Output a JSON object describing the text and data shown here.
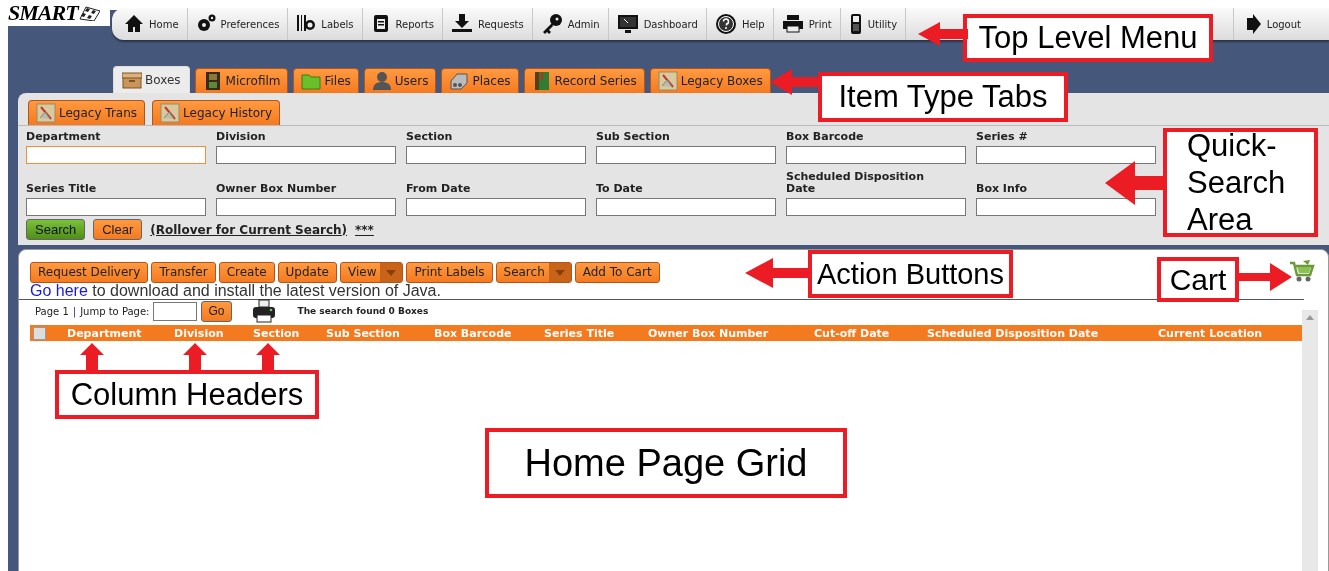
{
  "logo": {
    "text": "SMART"
  },
  "top_menu": [
    {
      "label": "Home"
    },
    {
      "label": "Preferences"
    },
    {
      "label": "Labels"
    },
    {
      "label": "Reports"
    },
    {
      "label": "Requests"
    },
    {
      "label": "Admin"
    },
    {
      "label": "Dashboard"
    },
    {
      "label": "Help"
    },
    {
      "label": "Print"
    },
    {
      "label": "Utility"
    }
  ],
  "logout": {
    "label": "Logout"
  },
  "item_tabs": [
    {
      "label": "Boxes",
      "selected": true
    },
    {
      "label": "Microfilm",
      "selected": false
    },
    {
      "label": "Files",
      "selected": false
    },
    {
      "label": "Users",
      "selected": false
    },
    {
      "label": "Places",
      "selected": false
    },
    {
      "label": "Record Series",
      "selected": false
    },
    {
      "label": "Legacy Boxes",
      "selected": false
    }
  ],
  "sub_tabs": [
    {
      "label": "Legacy Trans",
      "selected": false
    },
    {
      "label": "Legacy History",
      "selected": false
    }
  ],
  "quick_search": {
    "fields": [
      {
        "label": "Department",
        "focused": true
      },
      {
        "label": "Division",
        "focused": false
      },
      {
        "label": "Section",
        "focused": false
      },
      {
        "label": "Sub Section",
        "focused": false
      },
      {
        "label": "Box Barcode",
        "focused": false
      },
      {
        "label": "Series #",
        "focused": false
      },
      {
        "label": "Series Title",
        "focused": false
      },
      {
        "label": "Owner Box Number",
        "focused": false
      },
      {
        "label": "From Date",
        "focused": false
      },
      {
        "label": "To Date",
        "focused": false
      },
      {
        "label": "Scheduled Disposition Date",
        "focused": false
      },
      {
        "label": "Box Info",
        "focused": false
      }
    ],
    "buttons": [
      {
        "label": "Search",
        "kind": "primary"
      },
      {
        "label": "Clear",
        "kind": "secondary"
      }
    ],
    "rollover_link": "(Rollover for Current Search)",
    "more_link": "***"
  },
  "actions": [
    {
      "label": "Request Delivery",
      "dropdown": false
    },
    {
      "label": "Transfer",
      "dropdown": false
    },
    {
      "label": "Create",
      "dropdown": false
    },
    {
      "label": "Update",
      "dropdown": false
    },
    {
      "label": "View",
      "dropdown": true
    },
    {
      "label": "Print Labels",
      "dropdown": false
    },
    {
      "label": "Search",
      "dropdown": true
    },
    {
      "label": "Add To Cart",
      "dropdown": false
    }
  ],
  "java_notice": {
    "link": "Go here",
    "text": "to download and install the latest version of Java."
  },
  "pager": {
    "page": "Page 1",
    "separator": "|",
    "jump_label": "Jump to Page:",
    "go": "Go",
    "result": "The search found 0 Boxes"
  },
  "grid": {
    "select_all": false,
    "columns": [
      "Department",
      "Division",
      "Section",
      "Sub Section",
      "Box Barcode",
      "Series Title",
      "Owner Box Number",
      "Cut-off Date",
      "Scheduled Disposition Date",
      "Current Location"
    ]
  },
  "annotations": [
    {
      "kind": "menu",
      "text": "Top Level Menu"
    },
    {
      "kind": "tabs",
      "text": "Item Type Tabs"
    },
    {
      "kind": "search",
      "text": "Quick-Search Area"
    },
    {
      "kind": "actions",
      "text": "Action Buttons"
    },
    {
      "kind": "cart",
      "text": "Cart"
    },
    {
      "kind": "columns",
      "text": "Column Headers"
    },
    {
      "kind": "grid",
      "text": "Home Page Grid"
    }
  ]
}
